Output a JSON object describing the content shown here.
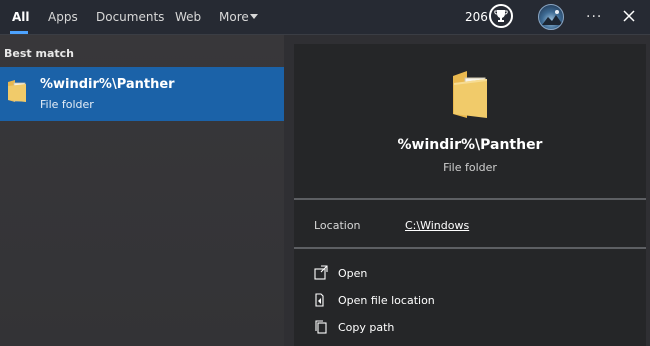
{
  "tabs": [
    {
      "label": "All"
    },
    {
      "label": "Apps"
    },
    {
      "label": "Documents"
    },
    {
      "label": "Web"
    },
    {
      "label": "More"
    }
  ],
  "header": {
    "points": "206",
    "more_menu_label": "···"
  },
  "left_panel": {
    "section_label": "Best match",
    "result": {
      "title": "%windir%\\Panther",
      "subtitle": "File folder"
    }
  },
  "detail": {
    "title": "%windir%\\Panther",
    "subtitle": "File folder",
    "location_label": "Location",
    "location_value": "C:\\Windows",
    "actions": [
      {
        "label": "Open",
        "icon": "open-icon"
      },
      {
        "label": "Open file location",
        "icon": "file-location-icon"
      },
      {
        "label": "Copy path",
        "icon": "copy-icon"
      }
    ]
  },
  "colors": {
    "accent": "#1b62a8",
    "tab_underline": "#4da3ff",
    "folder": "#f1cb6a"
  }
}
